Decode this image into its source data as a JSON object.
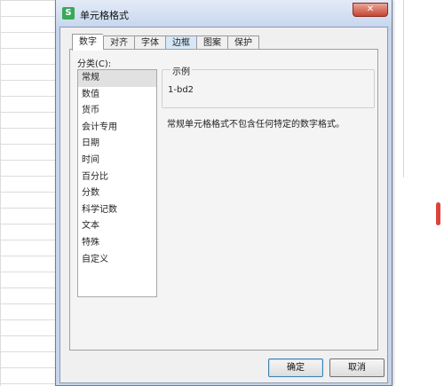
{
  "dialog": {
    "icon_glyph": "S",
    "title": "单元格格式",
    "close_glyph": "✕"
  },
  "tabs": [
    {
      "label": "数字"
    },
    {
      "label": "对齐"
    },
    {
      "label": "字体"
    },
    {
      "label": "边框"
    },
    {
      "label": "图案"
    },
    {
      "label": "保护"
    }
  ],
  "category": {
    "label": "分类(C):",
    "items": [
      "常规",
      "数值",
      "货币",
      "会计专用",
      "日期",
      "时间",
      "百分比",
      "分数",
      "科学记数",
      "文本",
      "特殊",
      "自定义"
    ],
    "selected": "常规"
  },
  "sample": {
    "label": "示例",
    "value": "1-bd2"
  },
  "description": "常规单元格格式不包含任何特定的数字格式。",
  "buttons": {
    "ok": "确定",
    "cancel": "取消"
  },
  "colors": {
    "app_icon": "#3aa857",
    "close_button": "#c64532",
    "scroll_marker": "#d9453a"
  }
}
